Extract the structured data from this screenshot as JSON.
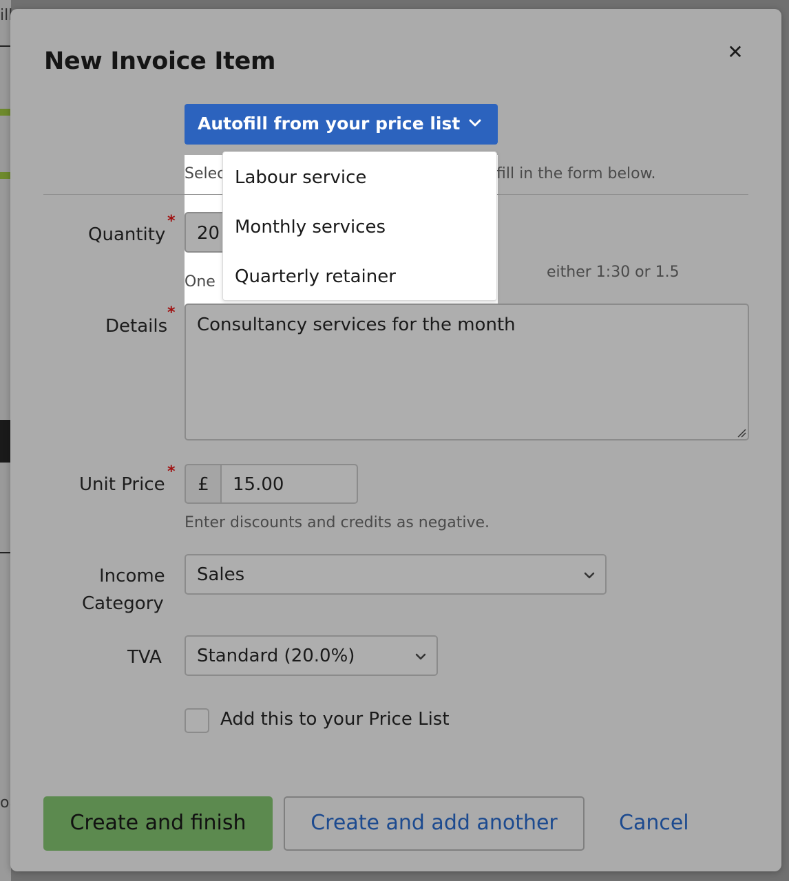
{
  "background": {
    "partial_text_top": "ill",
    "partial_text_bottom": "oa"
  },
  "modal": {
    "title": "New Invoice Item",
    "close_icon": "close-icon"
  },
  "autofill": {
    "button_label": "Autofill from your price list",
    "help_text_left": "Selec",
    "help_text_right": "fill in the form below.",
    "menu_items": [
      "Labour service",
      "Monthly services",
      "Quarterly retainer"
    ]
  },
  "form": {
    "quantity": {
      "label": "Quantity",
      "required": "*",
      "value": "20",
      "help_left": "One",
      "help_right": "either 1:30 or 1.5"
    },
    "details": {
      "label": "Details",
      "required": "*",
      "value": "Consultancy services for the month"
    },
    "unit_price": {
      "label": "Unit Price",
      "required": "*",
      "currency": "£",
      "value": "15.00",
      "help": "Enter discounts and credits as negative."
    },
    "income_category": {
      "label_line1": "Income",
      "label_line2": "Category",
      "selected": "Sales"
    },
    "tva": {
      "label": "TVA",
      "selected": "Standard (20.0%)"
    },
    "price_list_checkbox": {
      "label": "Add this to your Price List",
      "checked": false
    }
  },
  "actions": {
    "create_finish": "Create and finish",
    "create_add_another": "Create and add another",
    "cancel": "Cancel"
  },
  "colors": {
    "primary_blue": "#2c63be",
    "success_green": "#5c8a4f",
    "link_blue": "#1c4a8f",
    "required_red": "#a01010"
  }
}
